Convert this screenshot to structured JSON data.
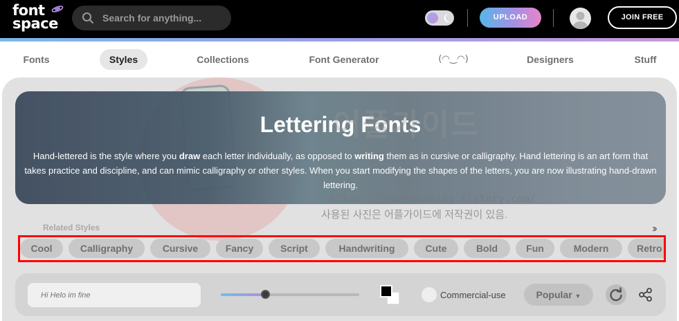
{
  "header": {
    "logo_line1": "font",
    "logo_line2": "space",
    "search_placeholder": "Search for anything...",
    "upload_label": "UPLOAD",
    "join_label": "JOIN FREE"
  },
  "nav": {
    "items": [
      {
        "label": "Fonts"
      },
      {
        "label": "Styles"
      },
      {
        "label": "Collections"
      },
      {
        "label": "Font Generator"
      },
      {
        "label": "(◠‿◠)"
      },
      {
        "label": "Designers"
      },
      {
        "label": "Stuff"
      }
    ],
    "active": "Styles"
  },
  "hero": {
    "title": "Lettering Fonts",
    "desc_part1": "Hand-lettered is the style where you ",
    "desc_bold1": "draw",
    "desc_part2": " each letter individually, as opposed to ",
    "desc_bold2": "writing",
    "desc_part3": " them as in cursive or calligraphy. Hand lettering is an art form that takes practice and discipline, and can mimic calligraphy or other styles. When you start modifying the shapes of the letters, you are now illustrating hand-drawn lettering."
  },
  "watermark": {
    "title": "어플가이드",
    "url": "https://greatmorning.tistory.com/",
    "note": "사용된 사진은 어플가이드에 저작권이 있음."
  },
  "related": {
    "label": "Related Styles",
    "more_icon": "double-chevron-right-icon",
    "chips": [
      {
        "label": "Cool"
      },
      {
        "label": "Calligraphy"
      },
      {
        "label": "Cursive"
      },
      {
        "label": "Fancy"
      },
      {
        "label": "Script"
      },
      {
        "label": "Handwriting"
      },
      {
        "label": "Cute"
      },
      {
        "label": "Bold"
      },
      {
        "label": "Fun"
      },
      {
        "label": "Modern"
      },
      {
        "label": "Retro"
      }
    ]
  },
  "toolbar": {
    "preview_placeholder": "Hi Helo im fine",
    "font_size_fraction": 0.32,
    "foreground_color": "#000000",
    "background_color": "#ffffff",
    "commercial_label": "Commercial-use",
    "commercial_checked": false,
    "sort_label": "Popular"
  },
  "colors": {
    "header_bg": "#000000",
    "accent_gradient": [
      "#56b7e8",
      "#a290e4",
      "#e985c6"
    ],
    "highlight_box": "#ff0000"
  }
}
